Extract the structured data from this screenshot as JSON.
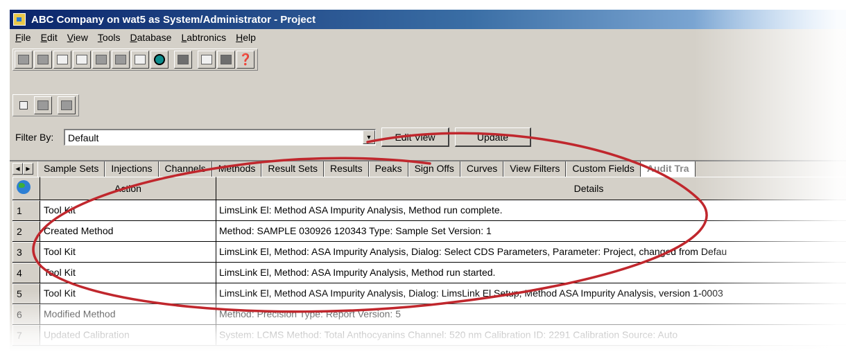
{
  "window": {
    "title": "ABC Company on wat5 as System/Administrator - Project"
  },
  "menu": [
    "File",
    "Edit",
    "View",
    "Tools",
    "Database",
    "Labtronics",
    "Help"
  ],
  "filter": {
    "label": "Filter By:",
    "selected": "Default",
    "edit_view_label": "Edit View",
    "update_label": "Update"
  },
  "tabs": [
    "Sample Sets",
    "Injections",
    "Channels",
    "Methods",
    "Result Sets",
    "Results",
    "Peaks",
    "Sign Offs",
    "Curves",
    "View Filters",
    "Custom Fields",
    "Audit Tra"
  ],
  "active_tab": "Audit Tra",
  "grid": {
    "headers": {
      "action": "Action",
      "details": "Details"
    },
    "rows": [
      {
        "num": "1",
        "action": "Tool Kit",
        "details": "LimsLink El: Method ASA Impurity Analysis, Method run complete."
      },
      {
        "num": "2",
        "action": "Created Method",
        "details": "Method: SAMPLE 030926 120343   Type: Sample Set   Version: 1"
      },
      {
        "num": "3",
        "action": "Tool Kit",
        "details": "LimsLink El, Method: ASA Impurity Analysis, Dialog: Select CDS Parameters, Parameter: Project, changed from Defau"
      },
      {
        "num": "4",
        "action": "Tool Kit",
        "details": "LimsLink El, Method: ASA Impurity Analysis, Method run started."
      },
      {
        "num": "5",
        "action": "Tool Kit",
        "details": "LimsLink El, Method ASA Impurity Analysis, Dialog: LimsLink El Setup, Method ASA Impurity Analysis, version 1-0003"
      },
      {
        "num": "6",
        "action": "Modified Method",
        "details": "Method: Precision   Type: Report   Version: 5"
      },
      {
        "num": "7",
        "action": "Updated Calibration",
        "details": "System: LCMS   Method: Total  Anthocyanins   Channel: 520 nm   Calibration ID: 2291   Calibration Source: Auto"
      }
    ]
  },
  "colors": {
    "titlebar": "#0a246a",
    "annotation_circle": "#c0272d",
    "face": "#d4d0c8"
  }
}
